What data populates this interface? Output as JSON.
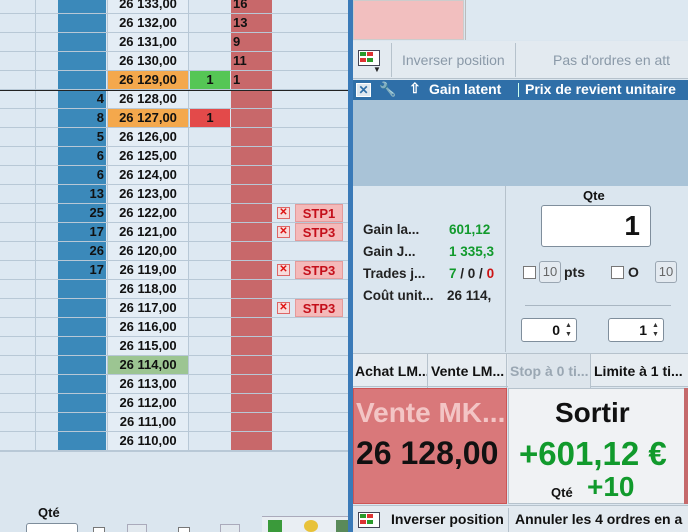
{
  "ladder": {
    "rows": [
      {
        "bid": "",
        "price": "26 133,00",
        "pos": "",
        "ask": "16",
        "order": "",
        "price_hl": ""
      },
      {
        "bid": "",
        "price": "26 132,00",
        "pos": "",
        "ask": "13",
        "order": "",
        "price_hl": ""
      },
      {
        "bid": "",
        "price": "26 131,00",
        "pos": "",
        "ask": "9",
        "order": "",
        "price_hl": ""
      },
      {
        "bid": "",
        "price": "26 130,00",
        "pos": "",
        "ask": "11",
        "order": "",
        "price_hl": ""
      },
      {
        "bid": "",
        "price": "26 129,00",
        "pos": "1",
        "ask": "1",
        "order": "",
        "price_hl": "orange",
        "pos_color": "green"
      },
      {
        "bid": "4",
        "price": "26 128,00",
        "pos": "",
        "ask": "",
        "order": "",
        "price_hl": ""
      },
      {
        "bid": "8",
        "price": "26 127,00",
        "pos": "1",
        "ask": "",
        "order": "",
        "price_hl": "orange",
        "pos_color": "red"
      },
      {
        "bid": "5",
        "price": "26 126,00",
        "pos": "",
        "ask": "",
        "order": "",
        "price_hl": ""
      },
      {
        "bid": "6",
        "price": "26 125,00",
        "pos": "",
        "ask": "",
        "order": "",
        "price_hl": ""
      },
      {
        "bid": "6",
        "price": "26 124,00",
        "pos": "",
        "ask": "",
        "order": "",
        "price_hl": ""
      },
      {
        "bid": "13",
        "price": "26 123,00",
        "pos": "",
        "ask": "",
        "order": "",
        "price_hl": ""
      },
      {
        "bid": "25",
        "price": "26 122,00",
        "pos": "",
        "ask": "",
        "order": "STP1",
        "price_hl": ""
      },
      {
        "bid": "17",
        "price": "26 121,00",
        "pos": "",
        "ask": "",
        "order": "STP3",
        "price_hl": ""
      },
      {
        "bid": "26",
        "price": "26 120,00",
        "pos": "",
        "ask": "",
        "order": "",
        "price_hl": ""
      },
      {
        "bid": "17",
        "price": "26 119,00",
        "pos": "",
        "ask": "",
        "order": "STP3",
        "price_hl": ""
      },
      {
        "bid": "",
        "price": "26 118,00",
        "pos": "",
        "ask": "",
        "order": "",
        "price_hl": ""
      },
      {
        "bid": "",
        "price": "26 117,00",
        "pos": "",
        "ask": "",
        "order": "STP3",
        "price_hl": ""
      },
      {
        "bid": "",
        "price": "26 116,00",
        "pos": "",
        "ask": "",
        "order": "",
        "price_hl": ""
      },
      {
        "bid": "",
        "price": "26 115,00",
        "pos": "",
        "ask": "",
        "order": "",
        "price_hl": ""
      },
      {
        "bid": "",
        "price": "26 114,00",
        "pos": "",
        "ask": "",
        "order": "",
        "price_hl": "green"
      },
      {
        "bid": "",
        "price": "26 113,00",
        "pos": "",
        "ask": "",
        "order": "",
        "price_hl": ""
      },
      {
        "bid": "",
        "price": "26 112,00",
        "pos": "",
        "ask": "",
        "order": "",
        "price_hl": ""
      },
      {
        "bid": "",
        "price": "26 111,00",
        "pos": "",
        "ask": "",
        "order": "",
        "price_hl": ""
      },
      {
        "bid": "",
        "price": "26 110,00",
        "pos": "",
        "ask": "",
        "order": "",
        "price_hl": ""
      }
    ],
    "bottom": {
      "qty_label": "Qté",
      "chk1_label": "0",
      "chk2_label": "O"
    }
  },
  "toolbar": {
    "invert_label": "Inverser position",
    "no_orders_label": "Pas d'ordres en att"
  },
  "tabs": {
    "gain_latent": "Gain latent",
    "prix_revient": "Prix de revient unitaire"
  },
  "stats": {
    "gain_latent_label": "Gain la...",
    "gain_latent_value": "601,12",
    "gain_jour_label": "Gain J...",
    "gain_jour_value": "1 335,3",
    "trades_label": "Trades j...",
    "trades_won": "7",
    "trades_sep1": " / ",
    "trades_neutral": "0",
    "trades_sep2": " / ",
    "trades_lost": "0",
    "cout_label": "Coût unit...",
    "cout_value": "26 114,"
  },
  "order_panel": {
    "qte_title": "Qte",
    "qte_value": "1",
    "pts_box": "10",
    "pts_label": "pts",
    "o_label": "O",
    "o_box": "10",
    "spin1_value": "0",
    "spin2_value": "1"
  },
  "order_buttons": {
    "achat": "Achat LM...",
    "vente": "Vente LM...",
    "stop": "Stop à 0 ti...",
    "limite": "Limite à 1 ti..."
  },
  "vente_block": {
    "label": "Vente MK...",
    "price": "26 128,00"
  },
  "sortir_block": {
    "label": "Sortir",
    "pnl": "+601,12 €",
    "qty_label": "Qté",
    "qty": "+10"
  },
  "bottom_bar": {
    "invert_label": "Inverser position",
    "cancel_label": "Annuler les 4 ordres en a"
  },
  "colors": {
    "accent_blue": "#3b89ba",
    "ask_red": "#c8686a",
    "gain_green": "#119a2c",
    "loss_red": "#cc1313",
    "highlight_orange": "#f4a84c"
  },
  "icons": [
    "grid-icon",
    "wrench-icon",
    "arrow-up-icon",
    "close-icon",
    "cancel-order-icon"
  ]
}
